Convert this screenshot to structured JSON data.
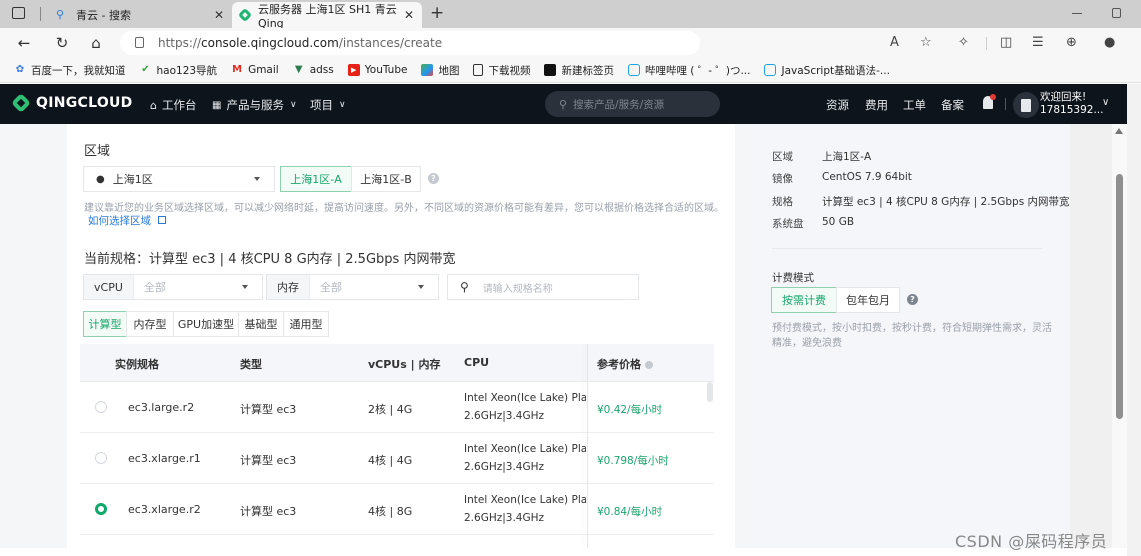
{
  "browser": {
    "tabs": [
      {
        "title": "青云 - 搜索",
        "active": false
      },
      {
        "title": "云服务器 上海1区 SH1 青云Qing",
        "active": true
      }
    ],
    "new_tab_label": "+",
    "url_prefix": "https://",
    "url_host": "console.qingcloud.com",
    "url_path": "/instances/create",
    "bookmarks": [
      {
        "label": "百度一下，我就知道",
        "icon": "baidu-icon"
      },
      {
        "label": "hao123导航",
        "icon": "hao123-icon"
      },
      {
        "label": "Gmail",
        "icon": "gmail-icon"
      },
      {
        "label": "adss",
        "icon": "vue-icon"
      },
      {
        "label": "YouTube",
        "icon": "youtube-icon"
      },
      {
        "label": "地图",
        "icon": "map-icon"
      },
      {
        "label": "下载视频",
        "icon": "page-icon"
      },
      {
        "label": "新建标签页",
        "icon": "black-square-icon"
      },
      {
        "label": "哔哩哔哩 ( ゜- ゜)つ...",
        "icon": "bilibili-icon"
      },
      {
        "label": "JavaScript基础语法-...",
        "icon": "bilibili-icon"
      }
    ]
  },
  "console_nav": {
    "brand": "QINGCLOUD",
    "items": [
      {
        "label": "工作台",
        "icon": "home-icon"
      },
      {
        "label": "产品与服务",
        "icon": "grid-icon",
        "dropdown": true
      },
      {
        "label": "项目",
        "dropdown": true
      }
    ],
    "search_placeholder": "搜索产品/服务/资源",
    "right_links": [
      "资源",
      "费用",
      "工单",
      "备案"
    ],
    "welcome_line1": "欢迎回来!",
    "welcome_line2": "17815392..."
  },
  "region": {
    "heading": "区域",
    "selected_region": "上海1区",
    "zones": [
      {
        "label": "上海1区-A",
        "active": true
      },
      {
        "label": "上海1区-B",
        "active": false
      }
    ],
    "hint": "建议靠近您的业务区域选择区域，可以减少网络时延，提高访问速度。另外，不同区域的资源价格可能有差异，您可以根据价格选择合适的区域。",
    "help_link": "如何选择区域"
  },
  "spec": {
    "current_label": "当前规格：计算型 ec3 | 4 核CPU 8 G内存 | 2.5Gbps 内网带宽",
    "filters": {
      "vcpu_label": "vCPU",
      "vcpu_value": "全部",
      "memory_label": "内存",
      "memory_value": "全部",
      "search_placeholder": "请输入规格名称"
    },
    "type_tabs": [
      {
        "label": "计算型",
        "active": true
      },
      {
        "label": "内存型",
        "active": false
      },
      {
        "label": "GPU加速型",
        "active": false
      },
      {
        "label": "基础型",
        "active": false
      },
      {
        "label": "通用型",
        "active": false
      }
    ],
    "table": {
      "headers": [
        "实例规格",
        "类型",
        "vCPUs | 内存",
        "CPU",
        "参考价格"
      ],
      "rows": [
        {
          "selected": false,
          "name": "ec3.large.r2",
          "type": "计算型 ec3",
          "vcpu_mem": "2核 | 4G",
          "cpu_line1": "Intel Xeon(Ice Lake) Platinu",
          "cpu_line2": "2.6GHz|3.4GHz",
          "price": "¥0.42/每小时"
        },
        {
          "selected": false,
          "name": "ec3.xlarge.r1",
          "type": "计算型 ec3",
          "vcpu_mem": "4核 | 4G",
          "cpu_line1": "Intel Xeon(Ice Lake) Platinu",
          "cpu_line2": "2.6GHz|3.4GHz",
          "price": "¥0.798/每小时"
        },
        {
          "selected": true,
          "name": "ec3.xlarge.r2",
          "type": "计算型 ec3",
          "vcpu_mem": "4核 | 8G",
          "cpu_line1": "Intel Xeon(Ice Lake) Platinu",
          "cpu_line2": "2.6GHz|3.4GHz",
          "price": "¥0.84/每小时"
        }
      ]
    }
  },
  "summary": {
    "items": [
      {
        "key": "区域",
        "value": "上海1区-A"
      },
      {
        "key": "镜像",
        "value": "CentOS 7.9 64bit"
      },
      {
        "key": "规格",
        "value": "计算型 ec3 | 4 核CPU 8 G内存 | 2.5Gbps 内网带宽"
      },
      {
        "key": "系统盘",
        "value": "50 GB"
      }
    ],
    "billing_title": "计费模式",
    "billing_options": [
      {
        "label": "按需计费",
        "active": true
      },
      {
        "label": "包年包月",
        "active": false
      }
    ],
    "billing_hint_line1": "预付费模式，按小时扣费，按秒计费，符合短期弹性需求，灵活",
    "billing_hint_line2": "精准，避免浪费"
  },
  "watermark": "CSDN @屎码程序员",
  "colors": {
    "accent_green": "#19a56c",
    "nav_bg": "#0d141c",
    "link_blue": "#2b7bd6"
  }
}
